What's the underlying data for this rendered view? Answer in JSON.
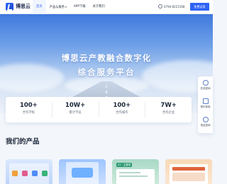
{
  "nav": {
    "logo_text": "博思云",
    "items": [
      {
        "label": "首页",
        "active": true,
        "caret": false
      },
      {
        "label": "产品与服务",
        "active": false,
        "caret": true
      },
      {
        "label": "APP下载",
        "active": false,
        "caret": false
      },
      {
        "label": "关于我们",
        "active": false,
        "caret": false
      }
    ],
    "caret_glyph": "▾",
    "phone": "0794-8221568",
    "trial_label": "免费试用"
  },
  "hero": {
    "title": "博思云产教融合数字化",
    "subtitle": "综合服务平台"
  },
  "stats": [
    {
      "value": "100+",
      "label": "合作学校"
    },
    {
      "value": "10W+",
      "label": "累计学员"
    },
    {
      "value": "100+",
      "label": "合作城市"
    },
    {
      "value": "7W+",
      "label": "合作企业"
    }
  ],
  "side_tools": [
    {
      "label": "在线咨询",
      "icon": "headset-icon"
    },
    {
      "label": "预约体验",
      "icon": "calendar-icon"
    },
    {
      "label": "电话咨询",
      "icon": "phone-icon"
    }
  ],
  "products": {
    "title": "我们的产品",
    "card2_chip": "01 · 主要项"
  },
  "colors": {
    "brand": "#2e63f5",
    "text": "#1b2638"
  }
}
